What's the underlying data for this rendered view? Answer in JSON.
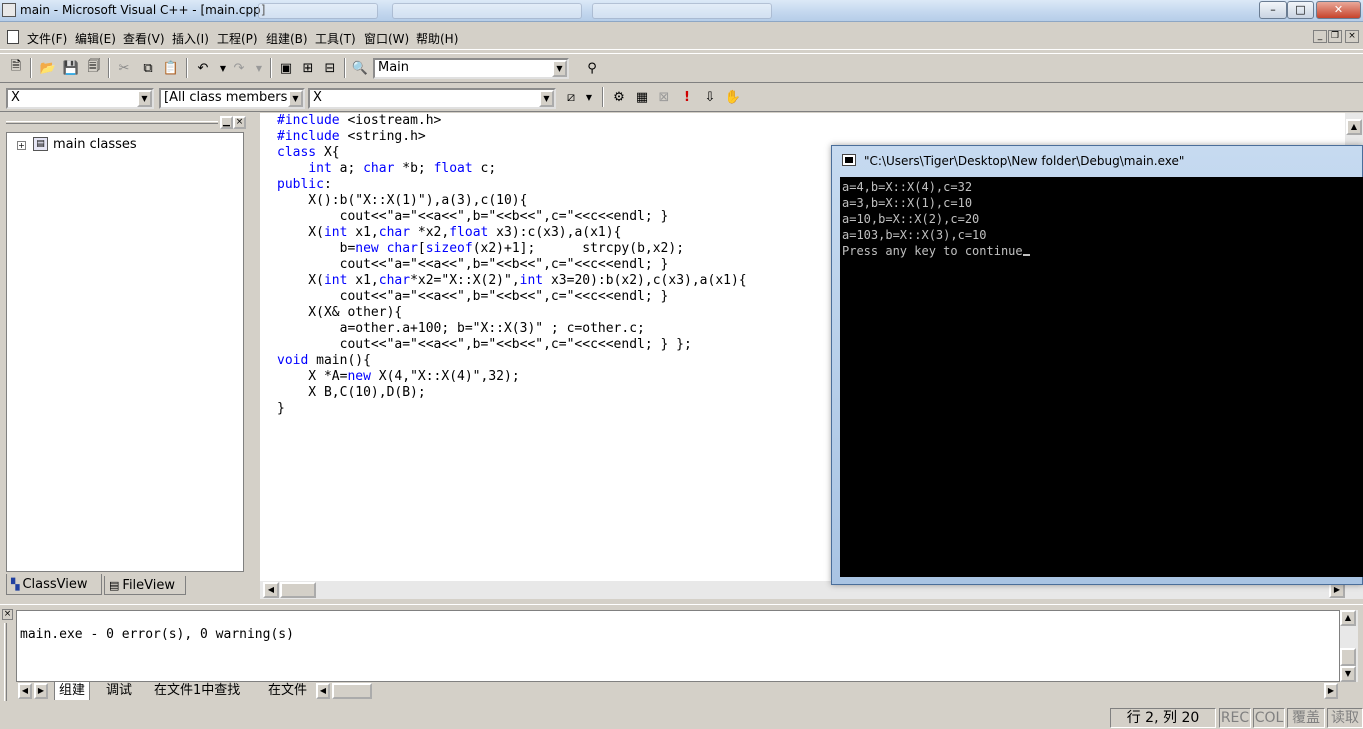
{
  "window": {
    "title": "main - Microsoft Visual C++ - [main.cpp]",
    "controls": {
      "minimize": "–",
      "maximize": "□",
      "close": "✕"
    }
  },
  "menu": {
    "items": [
      "文件(F)",
      "编辑(E)",
      "查看(V)",
      "插入(I)",
      "工程(P)",
      "组建(B)",
      "工具(T)",
      "窗口(W)",
      "帮助(H)"
    ]
  },
  "toolbar": {
    "config_combo": "Main",
    "class_combo": "X",
    "filter_combo": "[All class members]",
    "member_combo": "X"
  },
  "classview": {
    "root_label": "main classes",
    "tabs": [
      "ClassView",
      "FileView"
    ]
  },
  "editor": {
    "lines": [
      [
        [
          "kw",
          "#include"
        ],
        [
          "t",
          " <iostream.h>"
        ]
      ],
      [
        [
          "kw",
          "#include"
        ],
        [
          "t",
          " <string.h>"
        ]
      ],
      [
        [
          "kw",
          "class"
        ],
        [
          "t",
          " X{"
        ]
      ],
      [
        [
          "t",
          "    "
        ],
        [
          "kw",
          "int"
        ],
        [
          "t",
          " a; "
        ],
        [
          "kw",
          "char"
        ],
        [
          "t",
          " *b; "
        ],
        [
          "kw",
          "float"
        ],
        [
          "t",
          " c;"
        ]
      ],
      [
        [
          "kw",
          "public"
        ],
        [
          "t",
          ":"
        ]
      ],
      [
        [
          "t",
          "    X():b(\"X::X(1)\"),a(3),c(10){"
        ]
      ],
      [
        [
          "t",
          "        cout<<\"a=\"<<a<<\",b=\"<<b<<\",c=\"<<c<<endl; }"
        ]
      ],
      [
        [
          "t",
          "    X("
        ],
        [
          "kw",
          "int"
        ],
        [
          "t",
          " x1,"
        ],
        [
          "kw",
          "char"
        ],
        [
          "t",
          " *x2,"
        ],
        [
          "kw",
          "float"
        ],
        [
          "t",
          " x3):c(x3),a(x1){"
        ]
      ],
      [
        [
          "t",
          "        b="
        ],
        [
          "kw",
          "new"
        ],
        [
          "t",
          " "
        ],
        [
          "kw",
          "char"
        ],
        [
          "t",
          "["
        ],
        [
          "kw",
          "sizeof"
        ],
        [
          "t",
          "(x2)+1];      strcpy(b,x2);"
        ]
      ],
      [
        [
          "t",
          "        cout<<\"a=\"<<a<<\",b=\"<<b<<\",c=\"<<c<<endl; }"
        ]
      ],
      [
        [
          "t",
          "    X("
        ],
        [
          "kw",
          "int"
        ],
        [
          "t",
          " x1,"
        ],
        [
          "kw",
          "char"
        ],
        [
          "t",
          "*x2=\"X::X(2)\","
        ],
        [
          "kw",
          "int"
        ],
        [
          "t",
          " x3=20):b(x2),c(x3),a(x1){"
        ]
      ],
      [
        [
          "t",
          "        cout<<\"a=\"<<a<<\",b=\"<<b<<\",c=\"<<c<<endl; }"
        ]
      ],
      [
        [
          "t",
          "    X(X& other){"
        ]
      ],
      [
        [
          "t",
          "        a=other.a+100; b=\"X::X(3)\" ; c=other.c;"
        ]
      ],
      [
        [
          "t",
          "        cout<<\"a=\"<<a<<\",b=\"<<b<<\",c=\"<<c<<endl; } };"
        ]
      ],
      [
        [
          "kw",
          "void"
        ],
        [
          "t",
          " main(){"
        ]
      ],
      [
        [
          "t",
          "    X *A="
        ],
        [
          "kw",
          "new"
        ],
        [
          "t",
          " X(4,\"X::X(4)\",32);"
        ]
      ],
      [
        [
          "t",
          "    X B,C(10),D(B);"
        ]
      ],
      [
        [
          "t",
          "}"
        ]
      ]
    ]
  },
  "console": {
    "title": "\"C:\\Users\\Tiger\\Desktop\\New folder\\Debug\\main.exe\"",
    "lines": [
      "a=4,b=X::X(4),c=32",
      "a=3,b=X::X(1),c=10",
      "a=10,b=X::X(2),c=20",
      "a=103,b=X::X(3),c=10",
      "Press any key to continue"
    ]
  },
  "output": {
    "text": "main.exe - 0 error(s), 0 warning(s)",
    "tabs": [
      "组建",
      "调试",
      "在文件1中查找",
      "在文件"
    ]
  },
  "status": {
    "position": "行 2, 列 20",
    "rec": "REC",
    "col": "COL",
    "ovr": "覆盖",
    "read": "读取"
  },
  "colors": {
    "keyword": "#0000ff",
    "console_bg": "#000000",
    "console_fg": "#c0c0c0",
    "chrome": "#d4d0c8"
  }
}
